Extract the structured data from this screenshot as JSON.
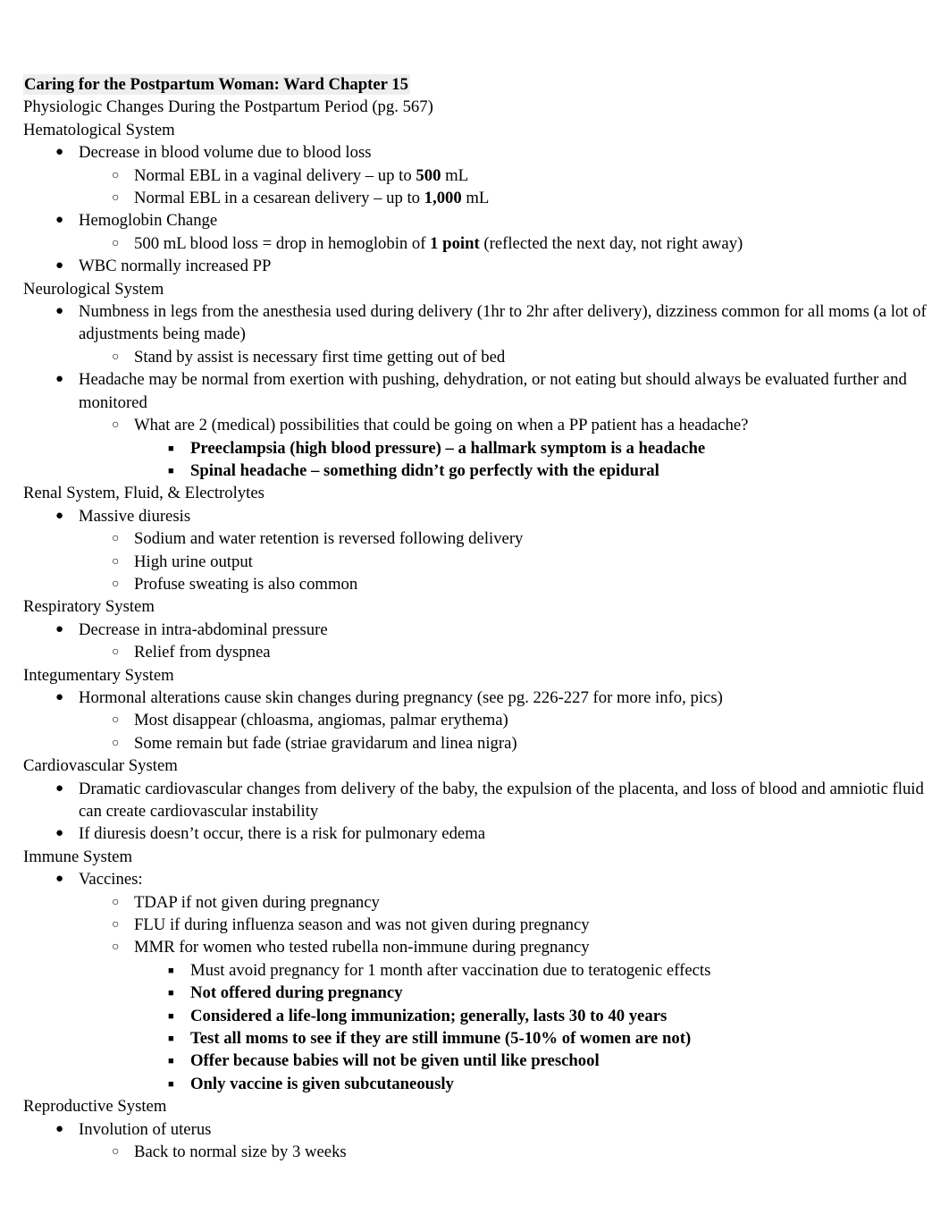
{
  "document": {
    "title": "Caring for the Postpartum Woman: Ward Chapter 15",
    "title_highlight_color": "#eeeeee",
    "subtitle": "Physiologic Changes During the Postpartum Period (pg. 567)",
    "bullet_glyphs": {
      "level1": "●",
      "level2": "○",
      "level3": "■"
    },
    "sections": [
      {
        "heading": "Hematological System",
        "items": [
          {
            "level": 1,
            "bold": false,
            "text": "Decrease in blood volume due to blood loss"
          },
          {
            "level": 2,
            "bold": false,
            "text_pre": "Normal EBL in a vaginal delivery – up to ",
            "text_bold": "500",
            "text_post": " mL"
          },
          {
            "level": 2,
            "bold": false,
            "text_pre": "Normal EBL in a cesarean delivery – up to ",
            "text_bold": "1,000",
            "text_post": " mL"
          },
          {
            "level": 1,
            "bold": false,
            "text": "Hemoglobin Change"
          },
          {
            "level": 2,
            "bold": false,
            "text_pre": "500 mL blood loss = drop in hemoglobin of ",
            "text_bold": "1 point",
            "text_post": " (reflected the next day, not right away)"
          },
          {
            "level": 1,
            "bold": false,
            "text": "WBC normally increased PP"
          }
        ]
      },
      {
        "heading": "Neurological System",
        "items": [
          {
            "level": 1,
            "bold": false,
            "text": "Numbness in legs from the anesthesia used during delivery (1hr to 2hr after delivery), dizziness common for all moms (a lot of adjustments being made)"
          },
          {
            "level": 2,
            "bold": false,
            "text": "Stand by assist is necessary first time getting out of bed"
          },
          {
            "level": 1,
            "bold": false,
            "text": "Headache may be normal from exertion with pushing, dehydration, or not eating but should always be evaluated further and monitored"
          },
          {
            "level": 2,
            "bold": false,
            "text": "What are 2 (medical) possibilities that could be going on when a PP patient has a headache?"
          },
          {
            "level": 3,
            "bold": true,
            "text": "Preeclampsia (high blood pressure) – a hallmark symptom is a headache"
          },
          {
            "level": 3,
            "bold": true,
            "text": "Spinal headache – something didn’t go perfectly with the epidural"
          }
        ]
      },
      {
        "heading": "Renal System, Fluid, & Electrolytes",
        "items": [
          {
            "level": 1,
            "bold": false,
            "text": "Massive diuresis"
          },
          {
            "level": 2,
            "bold": false,
            "text": "Sodium and water retention is reversed following delivery"
          },
          {
            "level": 2,
            "bold": false,
            "text": "High urine output"
          },
          {
            "level": 2,
            "bold": false,
            "text": "Profuse sweating is also common"
          }
        ]
      },
      {
        "heading": "Respiratory System",
        "items": [
          {
            "level": 1,
            "bold": false,
            "text": "Decrease in intra-abdominal pressure"
          },
          {
            "level": 2,
            "bold": false,
            "text": "Relief from dyspnea"
          }
        ]
      },
      {
        "heading": "Integumentary System",
        "items": [
          {
            "level": 1,
            "bold": false,
            "text": "Hormonal alterations cause skin changes during pregnancy (see pg. 226-227 for more info, pics)"
          },
          {
            "level": 2,
            "bold": false,
            "text": "Most disappear (chloasma, angiomas, palmar erythema)"
          },
          {
            "level": 2,
            "bold": false,
            "text": "Some remain but fade (striae gravidarum and linea nigra)"
          }
        ]
      },
      {
        "heading": "Cardiovascular System",
        "items": [
          {
            "level": 1,
            "bold": false,
            "text": "Dramatic cardiovascular changes from delivery of the baby, the expulsion of the placenta, and loss of blood and amniotic fluid can create cardiovascular instability"
          },
          {
            "level": 1,
            "bold": false,
            "text": "If diuresis doesn’t occur, there is a risk for pulmonary edema"
          }
        ]
      },
      {
        "heading": "Immune System",
        "items": [
          {
            "level": 1,
            "bold": false,
            "text": "Vaccines:"
          },
          {
            "level": 2,
            "bold": false,
            "text": "TDAP if not given during pregnancy"
          },
          {
            "level": 2,
            "bold": false,
            "text": "FLU if during influenza season and was not given during pregnancy"
          },
          {
            "level": 2,
            "bold": false,
            "text": "MMR for women who tested rubella non-immune during pregnancy"
          },
          {
            "level": 3,
            "bold": false,
            "text": "Must avoid pregnancy for 1 month after vaccination due to teratogenic effects"
          },
          {
            "level": 3,
            "bold": true,
            "text": "Not offered during pregnancy"
          },
          {
            "level": 3,
            "bold": true,
            "text": "Considered a life-long immunization; generally, lasts 30 to 40 years"
          },
          {
            "level": 3,
            "bold": true,
            "text": "Test all moms to see if they are still immune (5-10% of women are not)"
          },
          {
            "level": 3,
            "bold": true,
            "text": "Offer because babies will not be given until like preschool"
          },
          {
            "level": 3,
            "bold": true,
            "text": "Only vaccine is given subcutaneously"
          }
        ]
      },
      {
        "heading": "Reproductive System",
        "items": [
          {
            "level": 1,
            "bold": false,
            "text": "Involution of uterus"
          },
          {
            "level": 2,
            "bold": false,
            "text": "Back to normal size by 3 weeks"
          }
        ]
      }
    ]
  }
}
